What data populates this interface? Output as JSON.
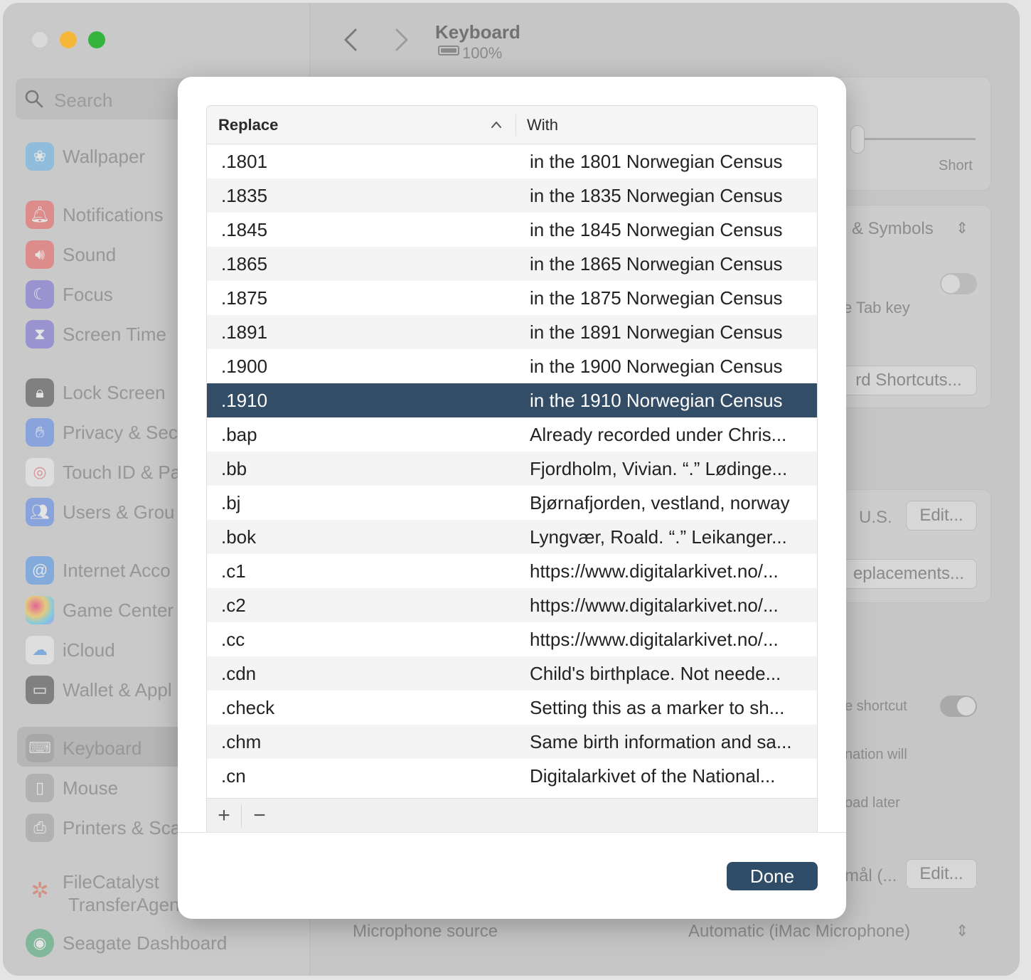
{
  "window": {
    "title": "Keyboard",
    "battery_text": "100%"
  },
  "sidebar": {
    "search_placeholder": "Search",
    "items": [
      {
        "label": "Wallpaper",
        "icon": "wallpaper-icon",
        "color": "#5ab2f0"
      },
      {
        "label": "Notifications",
        "icon": "bell-icon",
        "color": "#f0524f"
      },
      {
        "label": "Sound",
        "icon": "speaker-icon",
        "color": "#f0524f"
      },
      {
        "label": "Focus",
        "icon": "moon-icon",
        "color": "#6a5fd6"
      },
      {
        "label": "Screen Time",
        "icon": "hourglass-icon",
        "color": "#6a5fd6"
      },
      {
        "label": "Lock Screen",
        "icon": "lock-icon",
        "color": "#3a3a3a"
      },
      {
        "label": "Privacy & Sec",
        "icon": "hand-icon",
        "color": "#4b7ef0"
      },
      {
        "label": "Touch ID & Pa",
        "icon": "fingerprint-icon",
        "color": "#f4f4f4"
      },
      {
        "label": "Users & Grou",
        "icon": "users-icon",
        "color": "#4b7ef0"
      },
      {
        "label": "Internet Acco",
        "icon": "at-icon",
        "color": "#3d8ef0"
      },
      {
        "label": "Game Center",
        "icon": "game-center-icon",
        "color": "#e0e0e0"
      },
      {
        "label": "iCloud",
        "icon": "cloud-icon",
        "color": "#f4f4f4"
      },
      {
        "label": "Wallet & Appl",
        "icon": "wallet-icon",
        "color": "#3a3a3a"
      },
      {
        "label": "Keyboard",
        "icon": "keyboard-icon",
        "color": "#9a9a9a"
      },
      {
        "label": "Mouse",
        "icon": "mouse-icon",
        "color": "#9a9a9a"
      },
      {
        "label": "Printers & Sca",
        "icon": "printer-icon",
        "color": "#9a9a9a"
      },
      {
        "label": "FileCatalyst",
        "label2": "TransferAgen",
        "icon": "filecatalyst-icon",
        "color": "#e05a3a"
      },
      {
        "label": "Seagate Dashboard",
        "icon": "seagate-icon",
        "color": "#3aa66a"
      }
    ]
  },
  "background": {
    "short_label": "Short",
    "symbols_label": "i & Symbols",
    "tab_key_text": "e Tab key",
    "shortcuts_button": "rd Shortcuts...",
    "us_label": "U.S.",
    "edit_button_1": "Edit...",
    "replacements_button": "eplacements...",
    "shortcut_text": "e shortcut",
    "mation_text": "nation will",
    "later_text": "oad later",
    "mal_text": "mål (...",
    "edit_button_2": "Edit...",
    "microphone_label": "Microphone source",
    "microphone_value": "Automatic (iMac Microphone)"
  },
  "dialog": {
    "columns": {
      "replace": "Replace",
      "with": "With"
    },
    "rows": [
      {
        "replace": ".1801",
        "with": "in the 1801 Norwegian Census",
        "selected": false
      },
      {
        "replace": ".1835",
        "with": "in the 1835 Norwegian Census",
        "selected": false
      },
      {
        "replace": ".1845",
        "with": "in the 1845 Norwegian Census",
        "selected": false
      },
      {
        "replace": ".1865",
        "with": "in the 1865 Norwegian Census",
        "selected": false
      },
      {
        "replace": ".1875",
        "with": "in the 1875 Norwegian Census",
        "selected": false
      },
      {
        "replace": ".1891",
        "with": "in the 1891 Norwegian Census",
        "selected": false
      },
      {
        "replace": ".1900",
        "with": "in the 1900 Norwegian Census",
        "selected": false
      },
      {
        "replace": ".1910",
        "with": "in the 1910 Norwegian Census",
        "selected": true
      },
      {
        "replace": ".bap",
        "with": "Already recorded under Chris...",
        "selected": false
      },
      {
        "replace": ".bb",
        "with": "Fjordholm, Vivian. “.” Lødinge...",
        "selected": false
      },
      {
        "replace": ".bj",
        "with": "Bjørnafjorden, vestland, norway",
        "selected": false
      },
      {
        "replace": ".bok",
        "with": "Lyngvær, Roald. “.” Leikanger...",
        "selected": false
      },
      {
        "replace": ".c1",
        "with": "https://www.digitalarkivet.no/...",
        "selected": false
      },
      {
        "replace": ".c2",
        "with": "https://www.digitalarkivet.no/...",
        "selected": false
      },
      {
        "replace": ".cc",
        "with": "https://www.digitalarkivet.no/...",
        "selected": false
      },
      {
        "replace": ".cdn",
        "with": "Child's birthplace. Not neede...",
        "selected": false
      },
      {
        "replace": ".check",
        "with": "Setting this as a marker to sh...",
        "selected": false
      },
      {
        "replace": ".chm",
        "with": "Same birth information and sa...",
        "selected": false
      },
      {
        "replace": ".cn",
        "with": "Digitalarkivet of the National...",
        "selected": false
      }
    ],
    "add_label": "+",
    "remove_label": "−",
    "done_label": "Done",
    "accent_color": "#2f4c68",
    "selection_color": "#344d66"
  }
}
